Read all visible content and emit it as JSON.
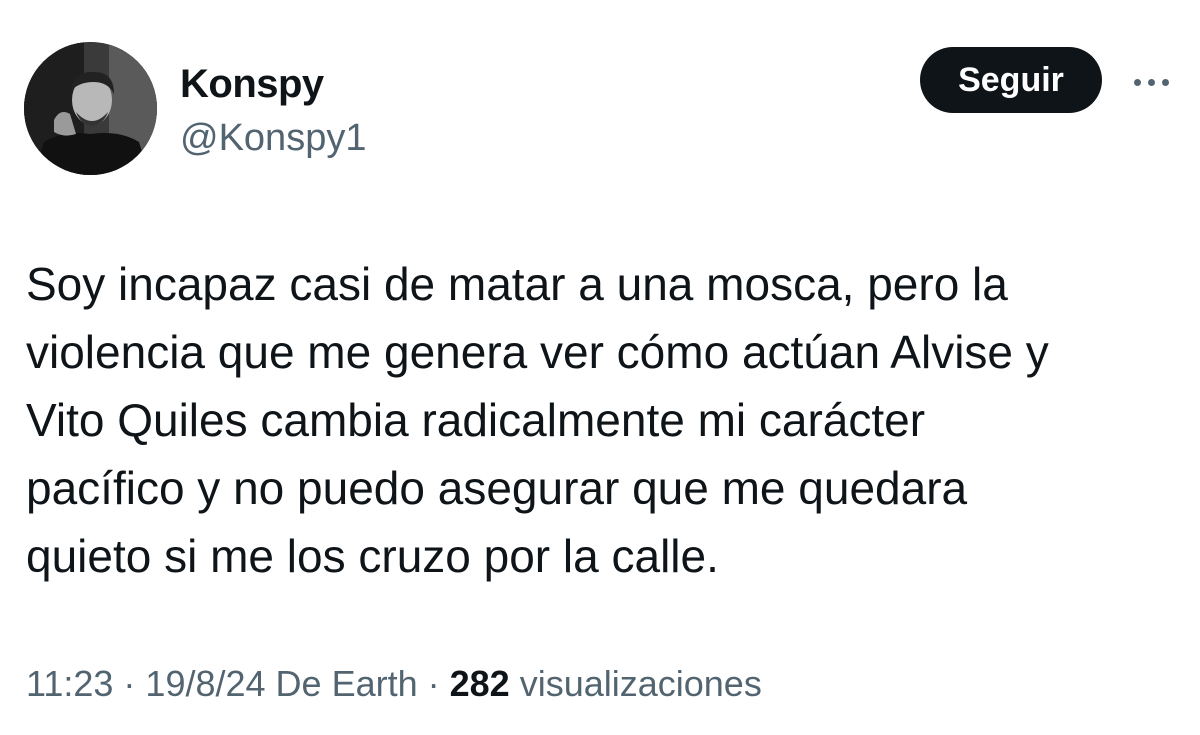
{
  "author": {
    "display_name": "Konspy",
    "handle": "@Konspy1",
    "avatar_icon": "profile-photo"
  },
  "actions": {
    "follow_label": "Seguir",
    "more_icon": "more-dots-icon"
  },
  "tweet": {
    "text": "Soy incapaz casi de matar a una mosca, pero la\nviolencia que me genera ver cómo actúan Alvise y\nVito Quiles cambia radicalmente mi carácter\npacífico y no puedo asegurar que me quedara\nquieto si me los cruzo por la calle."
  },
  "meta": {
    "time": "11:23",
    "separator": " · ",
    "date": "19/8/24",
    "source": " De Earth",
    "views_count": "282",
    "views_label": " visualizaciones"
  },
  "colors": {
    "text_primary": "#0f1419",
    "text_secondary": "#536471",
    "button_bg": "#0f1419",
    "button_text": "#ffffff"
  }
}
